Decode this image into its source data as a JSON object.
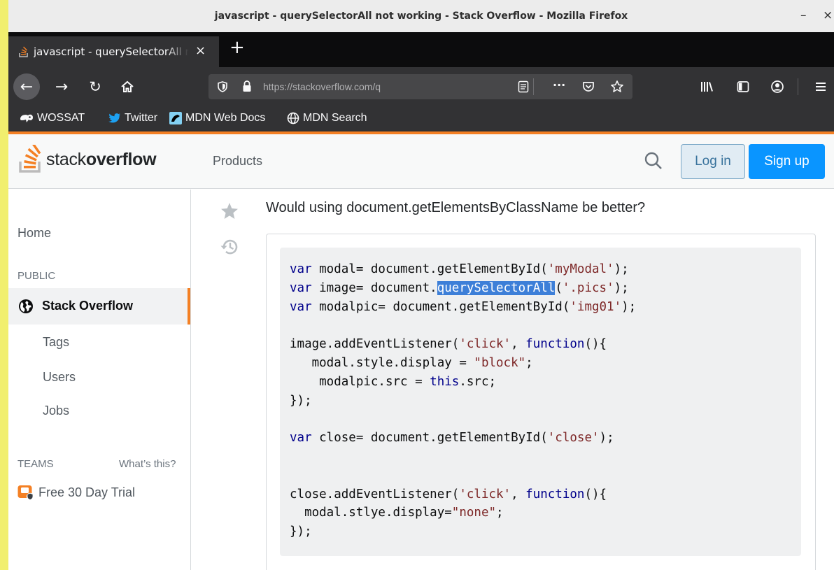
{
  "window": {
    "title": "javascript - querySelectorAll not working - Stack Overflow - Mozilla Firefox",
    "minimize_glyph": "–",
    "close_glyph": "×"
  },
  "tabs": [
    {
      "label": "javascript - querySelectorAll not working - Stack Overflow",
      "close_glyph": "×"
    }
  ],
  "new_tab_glyph": "+",
  "nav": {
    "back_glyph": "←",
    "forward_glyph": "→",
    "reload_glyph": "↻",
    "url": "https://stackoverflow.com/q",
    "more_glyph": "···"
  },
  "bookmarks": [
    {
      "label": "WOSSAT",
      "icon": "wossat-icon"
    },
    {
      "label": "Twitter",
      "icon": "twitter-icon"
    },
    {
      "label": "MDN Web Docs",
      "icon": "mdn-icon"
    },
    {
      "label": "MDN Search",
      "icon": "globe-icon"
    }
  ],
  "so_header": {
    "logo_light": "stack",
    "logo_bold": "overflow",
    "products": "Products",
    "login": "Log in",
    "signup": "Sign up"
  },
  "sidebar": {
    "home": "Home",
    "public": "PUBLIC",
    "stack_overflow": "Stack Overflow",
    "items": [
      "Tags",
      "Users",
      "Jobs"
    ],
    "teams": "TEAMS",
    "whats_this": "What’s this?",
    "trial": "Free 30 Day Trial"
  },
  "question": "Would using document.getElementsByClassName be better?",
  "code": {
    "l1": [
      "var",
      " modal= document.getElementById(",
      "'myModal'",
      ");"
    ],
    "l2": [
      "var",
      " image= document.",
      "querySelectorAll",
      "(",
      "'.pics'",
      ");"
    ],
    "l3": [
      "var",
      " modalpic= document.getElementById(",
      "'img01'",
      ");"
    ],
    "l5": [
      "image.addEventListener(",
      "'click'",
      ", ",
      "function",
      "(){"
    ],
    "l6": [
      "   modal.style.display = ",
      "\"block\"",
      ";"
    ],
    "l7": [
      "    modalpic.src = ",
      "this",
      ".src;"
    ],
    "l8": [
      "});"
    ],
    "l10": [
      "var",
      " close= document.getElementById(",
      "'close'",
      ");"
    ],
    "l13": [
      "close.addEventListener(",
      "'click'",
      ", ",
      "function",
      "(){"
    ],
    "l14": [
      "  modal.stlye.display=",
      "\"none\"",
      ";"
    ],
    "l15": [
      "});"
    ]
  },
  "colors": {
    "accent": "#f48024",
    "signup": "#0a95ff",
    "keyword": "#00008b",
    "string": "#7d2727",
    "selection": "#3d7fd8"
  }
}
